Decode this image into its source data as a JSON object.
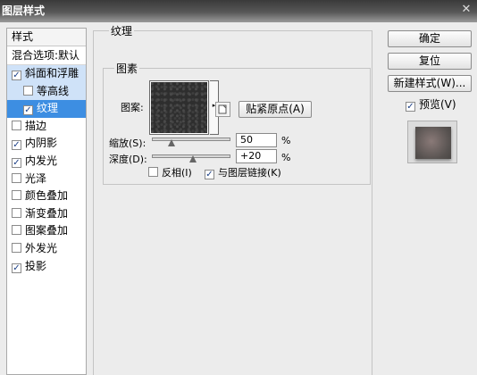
{
  "window": {
    "title": "图层样式",
    "close_glyph": "✕"
  },
  "style_list": {
    "header": "样式",
    "blend_options": "混合选项:默认",
    "items": [
      {
        "label": "斜面和浮雕",
        "checked": true
      },
      {
        "label": "等高线",
        "checked": false
      },
      {
        "label": "纹理",
        "checked": true
      },
      {
        "label": "描边",
        "checked": false
      },
      {
        "label": "内阴影",
        "checked": true
      },
      {
        "label": "内发光",
        "checked": true
      },
      {
        "label": "光泽",
        "checked": false
      },
      {
        "label": "颜色叠加",
        "checked": false
      },
      {
        "label": "渐变叠加",
        "checked": false
      },
      {
        "label": "图案叠加",
        "checked": false
      },
      {
        "label": "外发光",
        "checked": false
      },
      {
        "label": "投影",
        "checked": true
      }
    ]
  },
  "texture": {
    "group_title": "纹理",
    "elements_title": "图素",
    "pattern_label": "图案:",
    "snap_button": "贴紧原点(A)",
    "scale_label": "缩放(S):",
    "scale_value": "50",
    "scale_unit": "%",
    "scale_fraction": 0.5,
    "depth_label": "深度(D):",
    "depth_value": "+20",
    "depth_unit": "%",
    "invert_label": "反相(I)",
    "invert_checked": false,
    "link_label": "与图层链接(K)",
    "link_checked": true
  },
  "actions": {
    "ok": "确定",
    "reset": "复位",
    "new_style": "新建样式(W)...",
    "preview_label": "预览(V)",
    "preview_checked": true
  },
  "check_glyph": "✓",
  "dropdown_glyph": "▸"
}
